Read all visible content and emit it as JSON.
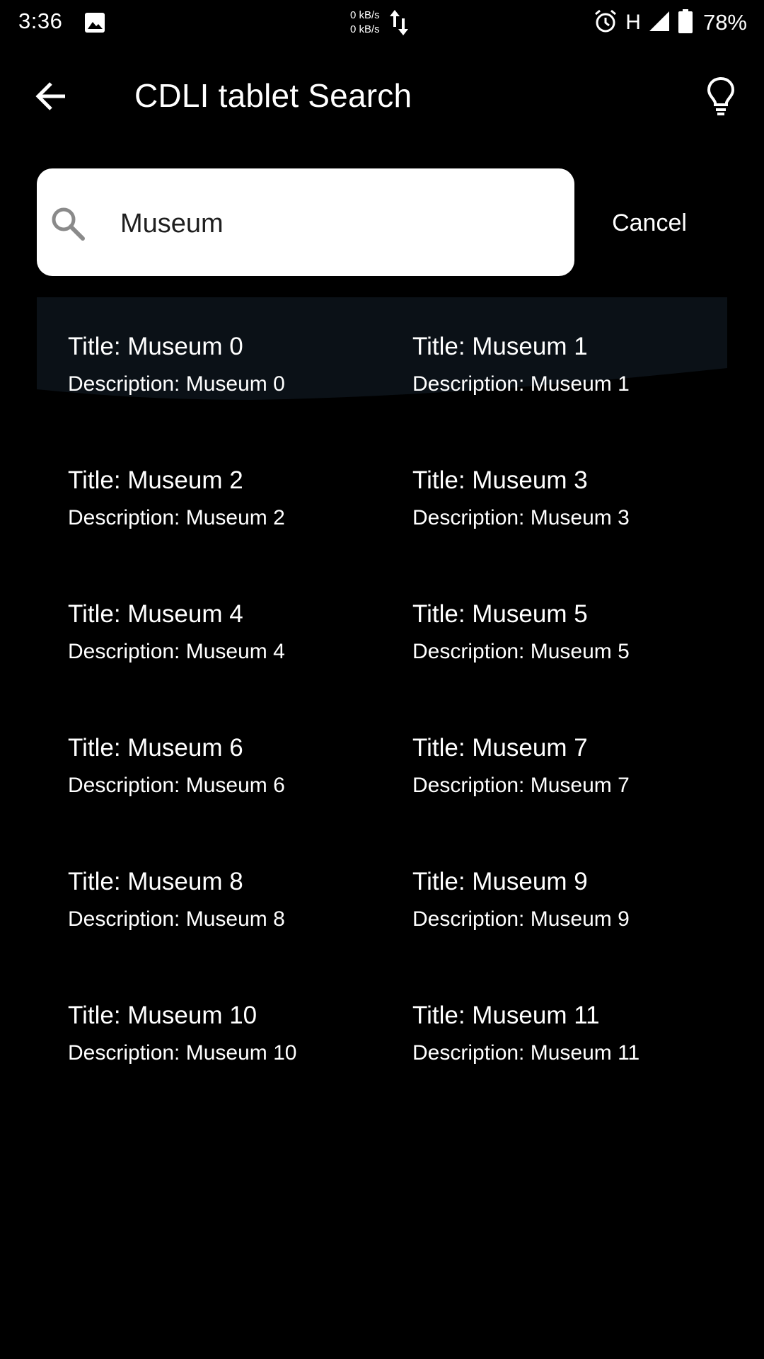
{
  "status_bar": {
    "time": "3:36",
    "net_up": "0 kB/s",
    "net_down": "0 kB/s",
    "network_type": "H",
    "battery": "78%",
    "icons": [
      "gallery-icon",
      "data-arrows-icon",
      "alarm-icon",
      "signal-icon",
      "battery-icon"
    ]
  },
  "app_bar": {
    "title": "CDLI tablet Search",
    "back_icon": "arrow-back-icon",
    "hint_icon": "lightbulb-icon"
  },
  "search": {
    "value": "Museum",
    "cancel_label": "Cancel",
    "icon": "search-icon"
  },
  "results": [
    {
      "title": "Title: Museum 0",
      "description": "Description: Museum 0"
    },
    {
      "title": "Title: Museum 1",
      "description": "Description: Museum 1"
    },
    {
      "title": "Title: Museum 2",
      "description": "Description: Museum 2"
    },
    {
      "title": "Title: Museum 3",
      "description": "Description: Museum 3"
    },
    {
      "title": "Title: Museum 4",
      "description": "Description: Museum 4"
    },
    {
      "title": "Title: Museum 5",
      "description": "Description: Museum 5"
    },
    {
      "title": "Title: Museum 6",
      "description": "Description: Museum 6"
    },
    {
      "title": "Title: Museum 7",
      "description": "Description: Museum 7"
    },
    {
      "title": "Title: Museum 8",
      "description": "Description: Museum 8"
    },
    {
      "title": "Title: Museum 9",
      "description": "Description: Museum 9"
    },
    {
      "title": "Title: Museum 10",
      "description": "Description: Museum 10"
    },
    {
      "title": "Title: Museum 11",
      "description": "Description: Museum 11"
    }
  ],
  "colors": {
    "background": "#000000",
    "text": "#ffffff",
    "search_box": "#ffffff",
    "search_text": "#1f1f1f",
    "search_icon": "#8a8a8a",
    "ripple": "#0b1117"
  }
}
